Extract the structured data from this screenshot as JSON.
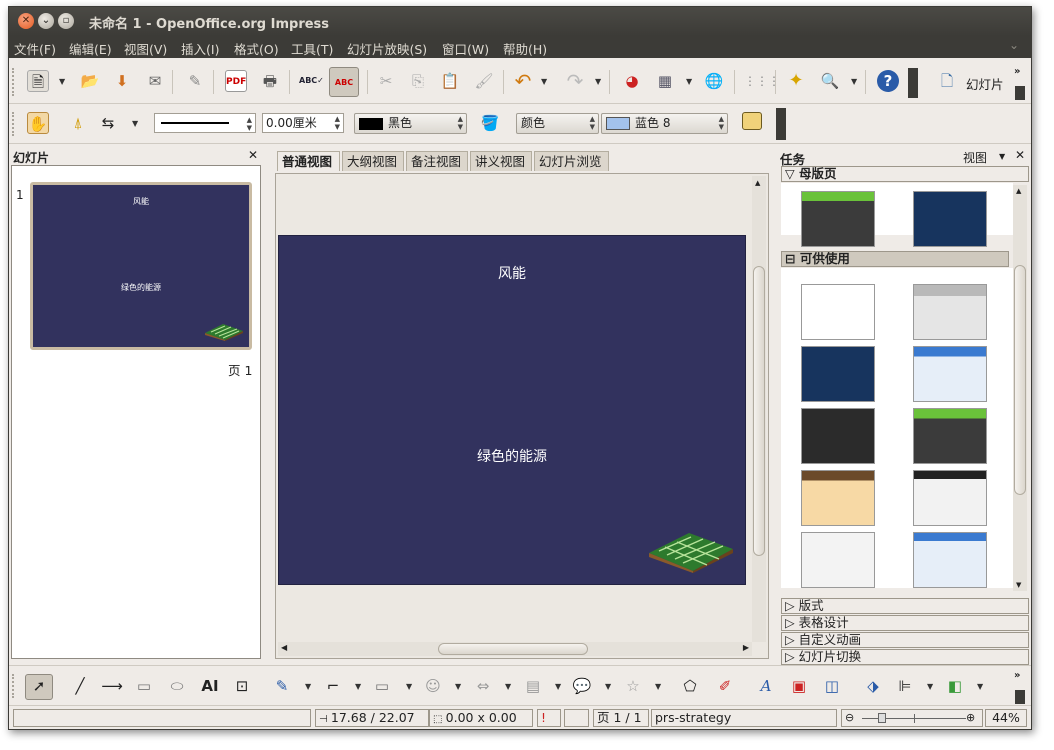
{
  "window": {
    "title": "未命名 1 - OpenOffice.org Impress"
  },
  "menu": [
    "文件(F)",
    "编辑(E)",
    "视图(V)",
    "插入(I)",
    "格式(O)",
    "工具(T)",
    "幻灯片放映(S)",
    "窗口(W)",
    "帮助(H)"
  ],
  "toolbar": {
    "slide_button_label": "幻灯片"
  },
  "line_area": {
    "width_value": "0.00厘米",
    "line_color": "黑色",
    "fill_type": "颜色",
    "fill_color": "蓝色 8",
    "line_color_hex": "#000000",
    "fill_color_hex": "#a3c2ec"
  },
  "slides_pane": {
    "title": "幻灯片",
    "slide_number": "1",
    "page_label": "页 1",
    "thumb_title": "风能",
    "thumb_subtitle": "绿色的能源"
  },
  "view_tabs": [
    "普通视图",
    "大纲视图",
    "备注视图",
    "讲义视图",
    "幻灯片浏览"
  ],
  "slide": {
    "title": "风能",
    "subtitle": "绿色的能源",
    "background": "#32325e"
  },
  "tasks": {
    "title": "任务",
    "view_label": "视图",
    "sections": {
      "master_pages": "母版页",
      "available": "可供使用",
      "layouts": "版式",
      "table_design": "表格设计",
      "custom_animation": "自定义动画",
      "slide_transition": "幻灯片切换"
    }
  },
  "status": {
    "position": "17.68 / 22.07",
    "size": "0.00 x 0.00",
    "page": "页 1 / 1",
    "master": "prs-strategy",
    "zoom": "44%"
  }
}
